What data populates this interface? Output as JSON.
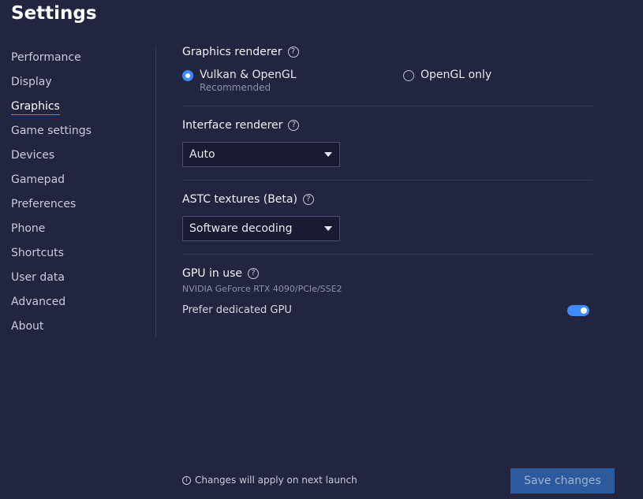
{
  "page_title": "Settings",
  "sidebar": {
    "items": [
      {
        "label": "Performance"
      },
      {
        "label": "Display"
      },
      {
        "label": "Graphics"
      },
      {
        "label": "Game settings"
      },
      {
        "label": "Devices"
      },
      {
        "label": "Gamepad"
      },
      {
        "label": "Preferences"
      },
      {
        "label": "Phone"
      },
      {
        "label": "Shortcuts"
      },
      {
        "label": "User data"
      },
      {
        "label": "Advanced"
      },
      {
        "label": "About"
      }
    ],
    "active": "Graphics"
  },
  "graphics_renderer": {
    "title": "Graphics renderer",
    "options": [
      {
        "label": "Vulkan & OpenGL",
        "sub": "Recommended",
        "selected": true
      },
      {
        "label": "OpenGL only",
        "selected": false
      }
    ]
  },
  "interface_renderer": {
    "title": "Interface renderer",
    "value": "Auto"
  },
  "astc_textures": {
    "title": "ASTC textures (Beta)",
    "value": "Software decoding"
  },
  "gpu": {
    "title": "GPU in use",
    "name": "NVIDIA GeForce RTX 4090/PCIe/SSE2",
    "prefer_dedicated_label": "Prefer dedicated GPU",
    "prefer_dedicated_enabled": true
  },
  "footer": {
    "note": "Changes will apply on next launch",
    "save_label": "Save changes"
  },
  "colors": {
    "background": "#23243f",
    "accent": "#3d8bff",
    "save_button": "#2d5a9c"
  },
  "icons": {
    "help": "?",
    "info": "i"
  }
}
